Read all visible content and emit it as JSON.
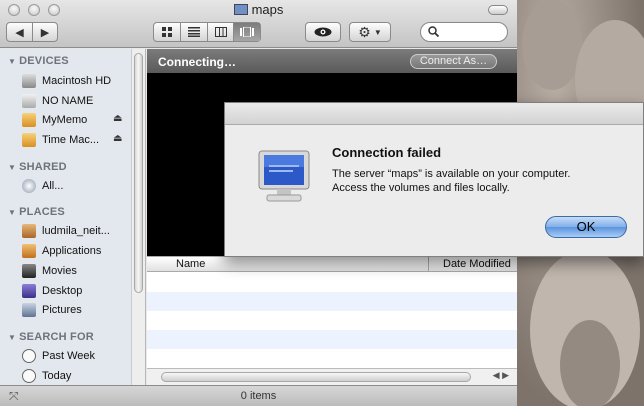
{
  "window": {
    "title": "maps"
  },
  "toolbar": {
    "back_glyph": "◀",
    "forward_glyph": "▶",
    "view_icons": [
      "icon-view-icon",
      "list-view-icon",
      "column-view-icon",
      "coverflow-view-icon"
    ],
    "active_view": 3,
    "search_placeholder": ""
  },
  "sidebar": {
    "sections": [
      {
        "header": "DEVICES",
        "items": [
          {
            "label": "Macintosh HD",
            "icon": "hard-disk-icon",
            "color": "#9a9a9a",
            "eject": false
          },
          {
            "label": "NO NAME",
            "icon": "drive-icon",
            "color": "#c9c9c9",
            "eject": false
          },
          {
            "label": "MyMemo",
            "icon": "usb-drive-icon",
            "color": "#e0a640",
            "eject": true
          },
          {
            "label": "Time Mac...",
            "icon": "usb-drive-icon",
            "color": "#e0a640",
            "eject": true
          }
        ]
      },
      {
        "header": "SHARED",
        "items": [
          {
            "label": "All...",
            "icon": "network-icon",
            "color": "#b8c4d6",
            "eject": false
          }
        ]
      },
      {
        "header": "PLACES",
        "items": [
          {
            "label": "ludmila_neit...",
            "icon": "home-icon",
            "color": "#c98b4a",
            "eject": false
          },
          {
            "label": "Applications",
            "icon": "applications-icon",
            "color": "#d48a2e",
            "eject": false
          },
          {
            "label": "Movies",
            "icon": "movies-icon",
            "color": "#555555",
            "eject": false
          },
          {
            "label": "Desktop",
            "icon": "desktop-icon",
            "color": "#5a4fa8",
            "eject": false
          },
          {
            "label": "Pictures",
            "icon": "pictures-icon",
            "color": "#7d8fa8",
            "eject": false
          }
        ]
      },
      {
        "header": "SEARCH FOR",
        "items": [
          {
            "label": "Past Week",
            "icon": "clock-icon",
            "color": "#dddddd",
            "eject": false
          },
          {
            "label": "Today",
            "icon": "clock-icon",
            "color": "#dddddd",
            "eject": false
          }
        ]
      }
    ]
  },
  "main": {
    "connecting_text": "Connecting…",
    "connect_as_label": "Connect As…",
    "columns": {
      "name": "Name",
      "date": "Date Modified"
    }
  },
  "status": {
    "text": "0 items"
  },
  "alert": {
    "title": "Connection failed",
    "message_line1": "The server “maps” is available on your computer.",
    "message_line2": "Access the volumes and files locally.",
    "ok_label": "OK"
  }
}
